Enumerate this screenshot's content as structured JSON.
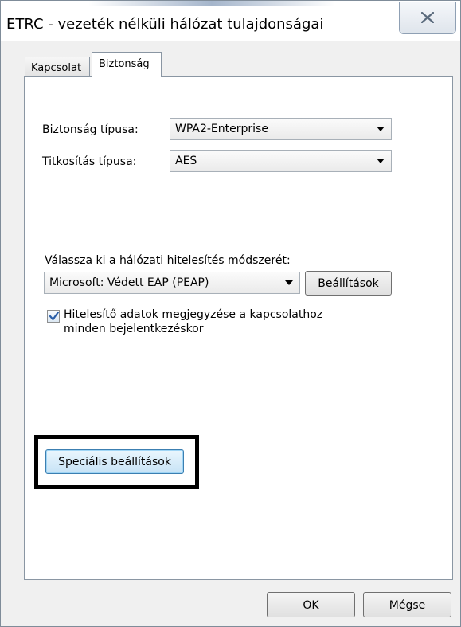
{
  "window": {
    "title": "ETRC - vezeték nélküli hálózat tulajdonságai",
    "close_icon": "close-x-icon"
  },
  "tabs": [
    {
      "label": "Kapcsolat",
      "active": false
    },
    {
      "label": "Biztonság",
      "active": true
    }
  ],
  "security": {
    "type_label": "Biztonság típusa:",
    "type_value": "WPA2-Enterprise",
    "encryption_label": "Titkosítás típusa:",
    "encryption_value": "AES",
    "auth_method_label": "Válassza ki a hálózati hitelesítés módszerét:",
    "auth_method_value": "Microsoft: Védett EAP (PEAP)",
    "settings_button": "Beállítások",
    "remember_checkbox": {
      "checked": true,
      "line1": "Hitelesítő adatok megjegyzése a kapcsolathoz",
      "line2": "minden bejelentkezéskor"
    },
    "advanced_button": "Speciális beállítások"
  },
  "footer": {
    "ok_button": "OK",
    "cancel_button": "Mégse"
  },
  "colors": {
    "window_bg": "#f0f0f0",
    "focus_button_bg": "#c7e3f6",
    "highlight_border": "#000000"
  }
}
